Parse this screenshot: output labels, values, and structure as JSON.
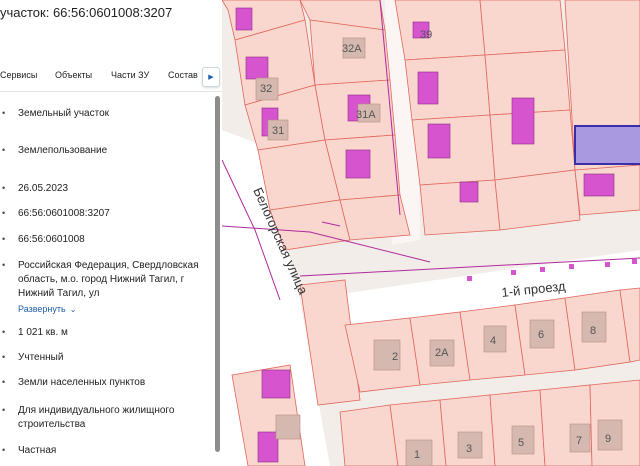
{
  "panel": {
    "title": "участок: 66:56:0601008:3207",
    "tabs": [
      "Сервисы",
      "Объекты",
      "Части ЗУ",
      "Состав"
    ],
    "details": {
      "type": "Земельный участок",
      "kind": "Землепользование",
      "date": "26.05.2023",
      "cadastral_number": "66:56:0601008:3207",
      "quarter": "66:56:0601008",
      "address": "Российская Федерация, Свердловская область, м.о. город Нижний Тагил, г Нижний Тагил, ул",
      "expand_link": "Развернуть",
      "area": "1 021 кв. м",
      "status": "Учтенный",
      "category": "Земли населенных пунктов",
      "permitted_use": "Для индивидуального жилищного строительства",
      "ownership": "Частная"
    }
  },
  "map": {
    "street_labels": [
      "Белогорская улица",
      "1-й проезд"
    ],
    "plot_numbers": [
      "32А",
      "39",
      "32",
      "31А",
      "31",
      "2",
      "2А",
      "4",
      "6",
      "8",
      "1",
      "3",
      "5",
      "7",
      "9"
    ],
    "colors": {
      "background": "#f2ede8",
      "parcel_fill": "#f9d6ce",
      "parcel_border": "#e0675e",
      "building": "#d655cf",
      "selected_plot": "#a999e0",
      "selected_border": "#3a2ea8",
      "utility_line": "#b02a9c",
      "road": "#ffffff"
    }
  }
}
